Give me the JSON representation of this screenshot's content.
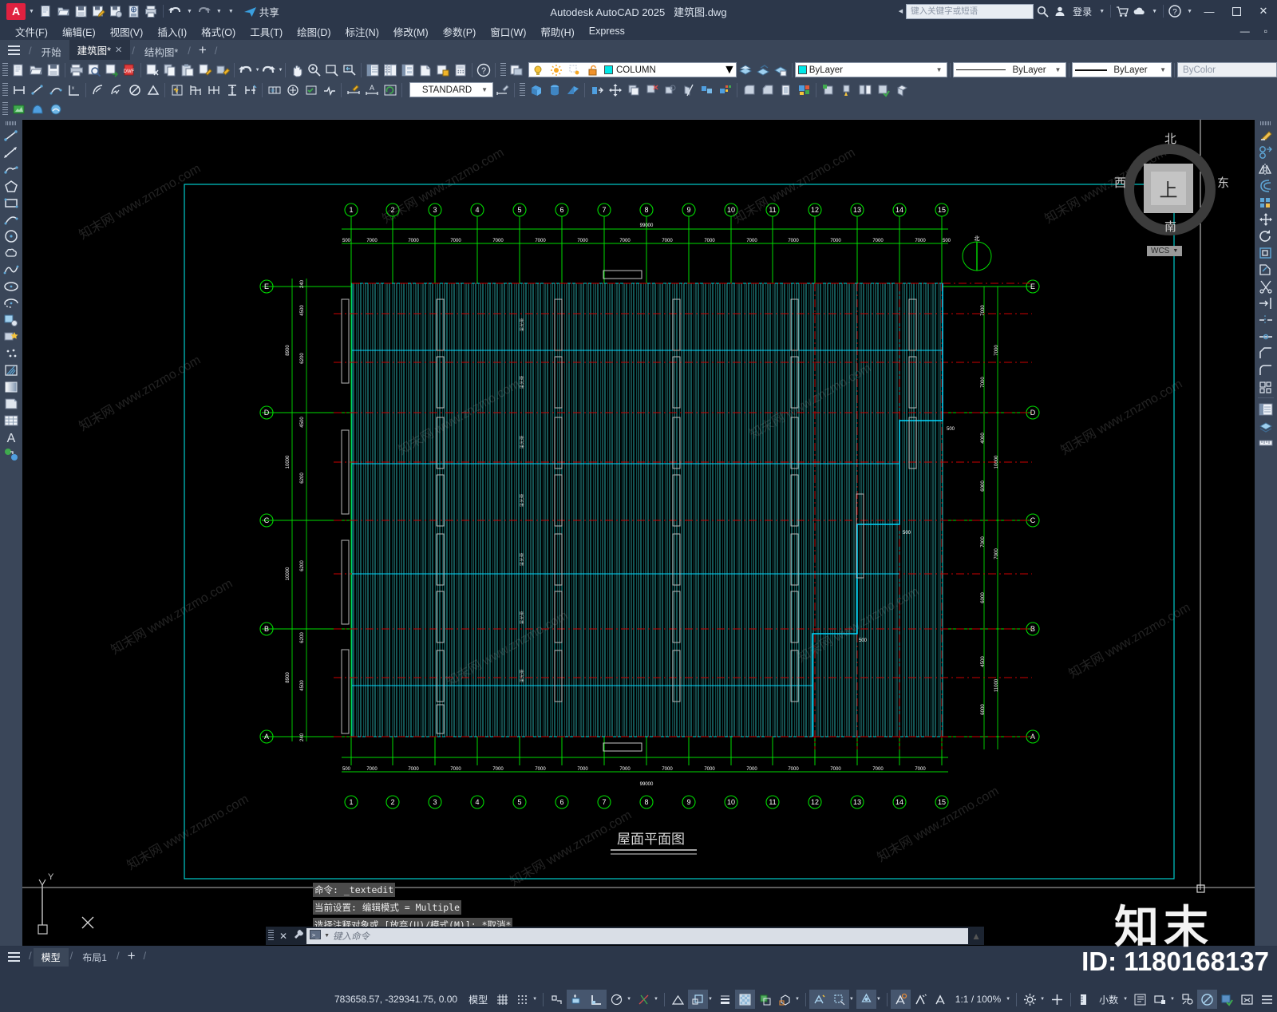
{
  "app": {
    "title": "Autodesk AutoCAD 2025",
    "document": "建筑图.dwg",
    "logo_letter": "A"
  },
  "titlebar": {
    "share_label": "共享",
    "quick_access_icons": [
      "new-file-icon",
      "open-file-icon",
      "save-icon",
      "save-as-icon",
      "plot-icon",
      "web-save-icon",
      "print-icon",
      "undo-icon",
      "redo-icon",
      "customize-icon"
    ],
    "search_placeholder": "键入关键字或短语",
    "search_icon": "search-icon",
    "account_label": "登录",
    "account_icon": "person-icon",
    "cart_icon": "cart-icon",
    "cloud_icon": "cloud-icon",
    "help_icon": "help-icon",
    "minimize": "—",
    "maximize": "▫",
    "close": "✕"
  },
  "menu": {
    "items": [
      "文件(F)",
      "编辑(E)",
      "视图(V)",
      "插入(I)",
      "格式(O)",
      "工具(T)",
      "绘图(D)",
      "标注(N)",
      "修改(M)",
      "参数(P)",
      "窗口(W)",
      "帮助(H)",
      "Express"
    ],
    "right_min": "—",
    "right_max": "▫"
  },
  "file_tabs": {
    "start_label": "开始",
    "tabs": [
      {
        "label": "建筑图*",
        "active": true,
        "close": "✕"
      },
      {
        "label": "结构图*",
        "active": false,
        "close": ""
      }
    ],
    "add_label": "+"
  },
  "toolbar": {
    "layer_combo": {
      "value": "COLUMN",
      "color": "#00e8e8"
    },
    "style_combo": {
      "value": "STANDARD"
    },
    "color_combo": {
      "value": "ByLayer",
      "color": "#00e8e8"
    },
    "linetype_combo": {
      "value": "ByLayer"
    },
    "lineweight_combo": {
      "value": "ByLayer"
    },
    "transparency_combo": {
      "value": "ByColor"
    }
  },
  "viewcube": {
    "north": "北",
    "south": "南",
    "east": "东",
    "west": "西",
    "top": "上",
    "ucs": "WCS"
  },
  "drawing": {
    "title": "屋面平面图",
    "column_grid_labels": [
      "1",
      "2",
      "3",
      "4",
      "5",
      "6",
      "7",
      "8",
      "9",
      "10",
      "11",
      "12",
      "13",
      "14",
      "15"
    ],
    "row_grid_labels": [
      "A",
      "B",
      "C",
      "D",
      "E"
    ],
    "bay_dimension": "7000",
    "edge_dimension": "500",
    "overall_dimension": "99000",
    "vertical_dims": [
      "240",
      "4500",
      "6200",
      "4500",
      "6200",
      "6200",
      "6200",
      "4500",
      "6200",
      "240"
    ],
    "vertical_totals": [
      "8900",
      "10000",
      "10000",
      "8900"
    ],
    "right_dims": [
      "7000",
      "7000",
      "4000",
      "6000",
      "6000",
      "7000",
      "4500",
      "6000"
    ],
    "right_totals": [
      "7000",
      "7000",
      "10000",
      "11000"
    ],
    "offset_note": "500",
    "ucs_x": "X",
    "ucs_y": "Y"
  },
  "command": {
    "history": [
      "命令: _textedit",
      "当前设置: 编辑模式 = Multiple",
      "选择注释对象或 [放弃(U)/模式(M)]: *取消*"
    ],
    "placeholder": "键入命令",
    "close_icon": "✕",
    "settings_icon": "wrench-icon",
    "prompt_icon": "console-icon"
  },
  "layout_tabs": {
    "model": "模型",
    "layouts": [
      "布局1"
    ],
    "add": "+"
  },
  "status_bar": {
    "coordinates": "783658.57, -329341.75, 0.00",
    "space": "模型",
    "scale": "1:1 / 100%",
    "units": "小数",
    "icons": [
      "grid-icon",
      "snap-icon",
      "snap-dropdown",
      "infer-constraints-icon",
      "dynamic-input-icon",
      "ortho-icon",
      "polar-icon",
      "osnap-icon",
      "osnap-dropdown",
      "3dosnap-icon",
      "otrack-icon",
      "lineweight-icon",
      "transparency-icon",
      "selection-cycling-icon",
      "3dobject-icon",
      "ucs-icon",
      "annotation-visibility-icon",
      "autoscale-icon",
      "annotation-scale-icon",
      "workspace-icon",
      "customization-icon",
      "units-icon",
      "quick-properties-icon",
      "lock-ui-icon",
      "isolate-objects-icon",
      "hardware-accel-icon",
      "clean-screen-icon",
      "fullscreen-icon",
      "menu-icon"
    ]
  },
  "watermark": {
    "site": "知末网 www.znzmo.com",
    "brand": "知末",
    "id": "ID: 1180168137"
  }
}
